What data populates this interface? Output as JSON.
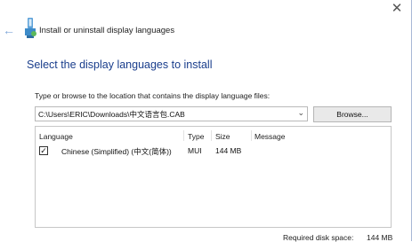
{
  "window": {
    "title": "Install or uninstall display languages",
    "close_glyph": "✕",
    "back_glyph": "←",
    "icons": [
      "back-arrow-icon",
      "language-install-icon",
      "close-icon"
    ]
  },
  "main": {
    "heading": "Select the display languages to install",
    "path_label": "Type or browse to the location that contains the display language files:",
    "path_value": "C:\\Users\\ERIC\\Downloads\\中文语言包.CAB",
    "browse_label": "Browse...",
    "dropdown_glyph": "⌄"
  },
  "list": {
    "columns": {
      "language": "Language",
      "type": "Type",
      "size": "Size",
      "message": "Message"
    },
    "rows": [
      {
        "checked": true,
        "check_glyph": "✓",
        "language": "Chinese (Simplified) (中文(简体))",
        "type": "MUI",
        "size": "144 MB",
        "message": ""
      }
    ]
  },
  "footer": {
    "disk_space_label": "Required disk space:",
    "disk_space_value": "144 MB"
  },
  "colors": {
    "heading": "#1a3e8c",
    "border": "#a9b8d6",
    "button": "#e9e9e9"
  }
}
